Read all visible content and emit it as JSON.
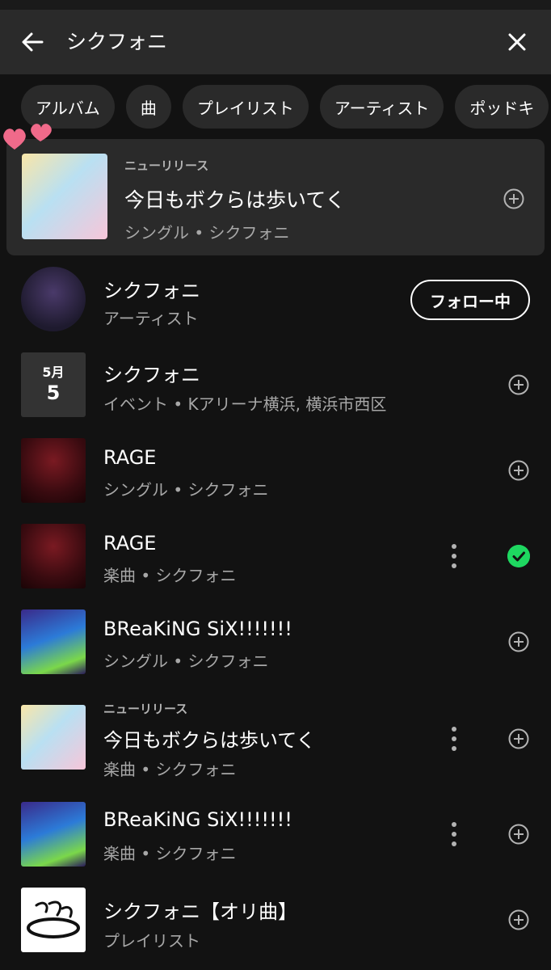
{
  "search": {
    "query": "シクフォニ"
  },
  "chips": [
    "アルバム",
    "曲",
    "プレイリスト",
    "アーティスト",
    "ポッドキ"
  ],
  "new_release_card": {
    "tag": "ニューリリース",
    "title": "今日もボクらは歩いてく",
    "subtitle": "シングル • シクフォニ"
  },
  "artist_row": {
    "title": "シクフォニ",
    "subtitle": "アーティスト",
    "follow_label": "フォロー中"
  },
  "event_row": {
    "month": "5月",
    "day": "5",
    "title": "シクフォニ",
    "subtitle": "イベント • Kアリーナ横浜, 横浜市西区"
  },
  "rage_single": {
    "title": "RAGE",
    "subtitle": "シングル • シクフォニ"
  },
  "rage_song": {
    "title": "RAGE",
    "subtitle": "楽曲 • シクフォニ"
  },
  "bs_single": {
    "title": "BReaKiNG SiX!!!!!!!",
    "subtitle": "シングル • シクフォニ"
  },
  "nr_song": {
    "tag": "ニューリリース",
    "title": "今日もボクらは歩いてく",
    "subtitle": "楽曲 • シクフォニ"
  },
  "bs_song": {
    "title": "BReaKiNG SiX!!!!!!!",
    "subtitle": "楽曲 • シクフォニ"
  },
  "playlist_row": {
    "title": "シクフォニ【オリ曲】",
    "subtitle": "プレイリスト"
  },
  "colors": {
    "background": "#121212",
    "surface": "#2a2a2a",
    "accent_green": "#1ed760",
    "muted_text": "#a7a7a7",
    "hearts": "#f06a8a"
  }
}
